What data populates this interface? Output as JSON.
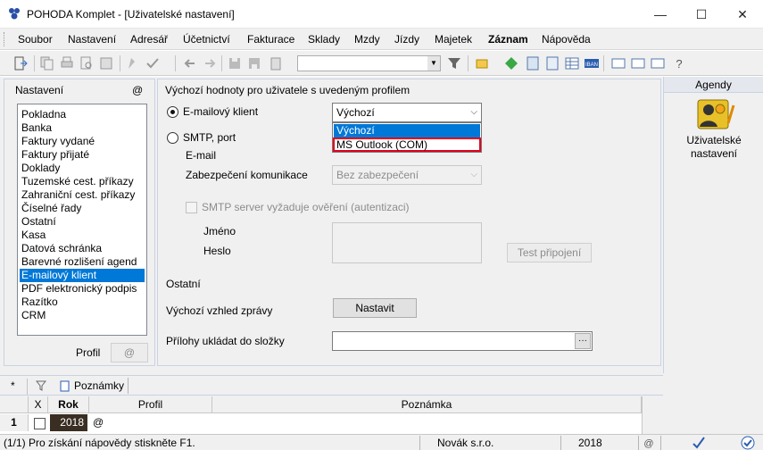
{
  "window": {
    "title": "POHODA Komplet - [Uživatelské nastavení]",
    "minimize": "—",
    "maximize": "☐",
    "close": "✕"
  },
  "menu": [
    "Soubor",
    "Nastavení",
    "Adresář",
    "Účetnictví",
    "Fakturace",
    "Sklady",
    "Mzdy",
    "Jízdy",
    "Majetek",
    "Záznam",
    "Nápověda"
  ],
  "left": {
    "header": "Nastavení",
    "header_icon": "@",
    "items": [
      "Pokladna",
      "Banka",
      "Faktury vydané",
      "Faktury přijaté",
      "Doklady",
      "Tuzemské cest. příkazy",
      "Zahraniční cest. příkazy",
      "Číselné řady",
      "Ostatní",
      "Kasa",
      "Datová schránka",
      "Barevné rozlišení agend",
      "E-mailový klient",
      "PDF elektronický podpis",
      "Razítko",
      "CRM"
    ],
    "selected_index": 12,
    "profile_label": "Profil",
    "profile_button": "@"
  },
  "center": {
    "heading": "Výchozí hodnoty pro uživatele s uvedeným profilem",
    "radio_email": "E-mailový klient",
    "email_combo_value": "Výchozí",
    "radio_smtp": "SMTP, port",
    "email_label": "E-mail",
    "security_label": "Zabezpečení komunikace",
    "security_value": "Bez zabezpečení",
    "smtp_auth_label": "SMTP server vyžaduje ověření (autentizaci)",
    "name_label": "Jméno",
    "password_label": "Heslo",
    "test_button": "Test připojení",
    "other_heading": "Ostatní",
    "default_view_label": "Výchozí vzhled zprávy",
    "set_button": "Nastavit",
    "attachments_label": "Přílohy ukládat do složky",
    "browse_button": "···"
  },
  "dropdown": {
    "options": [
      "Výchozí",
      "MS Outlook (COM)"
    ],
    "highlighted_index": 0,
    "marked_index": 1
  },
  "right": {
    "header": "Agendy",
    "item_label": "Uživatelské nastavení"
  },
  "notes": {
    "star": "*",
    "tab_label": "Poznámky",
    "columns": [
      "X",
      "Rok",
      "Profil",
      "Poznámka"
    ],
    "row": {
      "num": "1",
      "x": "",
      "rok": "2018",
      "profil": "@",
      "poznamka": ""
    }
  },
  "status": {
    "help": "(1/1) Pro získání nápovědy stiskněte F1.",
    "company": "Novák s.r.o.",
    "year": "2018"
  },
  "colors": {
    "selection": "#0078d7",
    "highlight_border": "#e3001b",
    "panel_bg": "#f0f0f0"
  }
}
